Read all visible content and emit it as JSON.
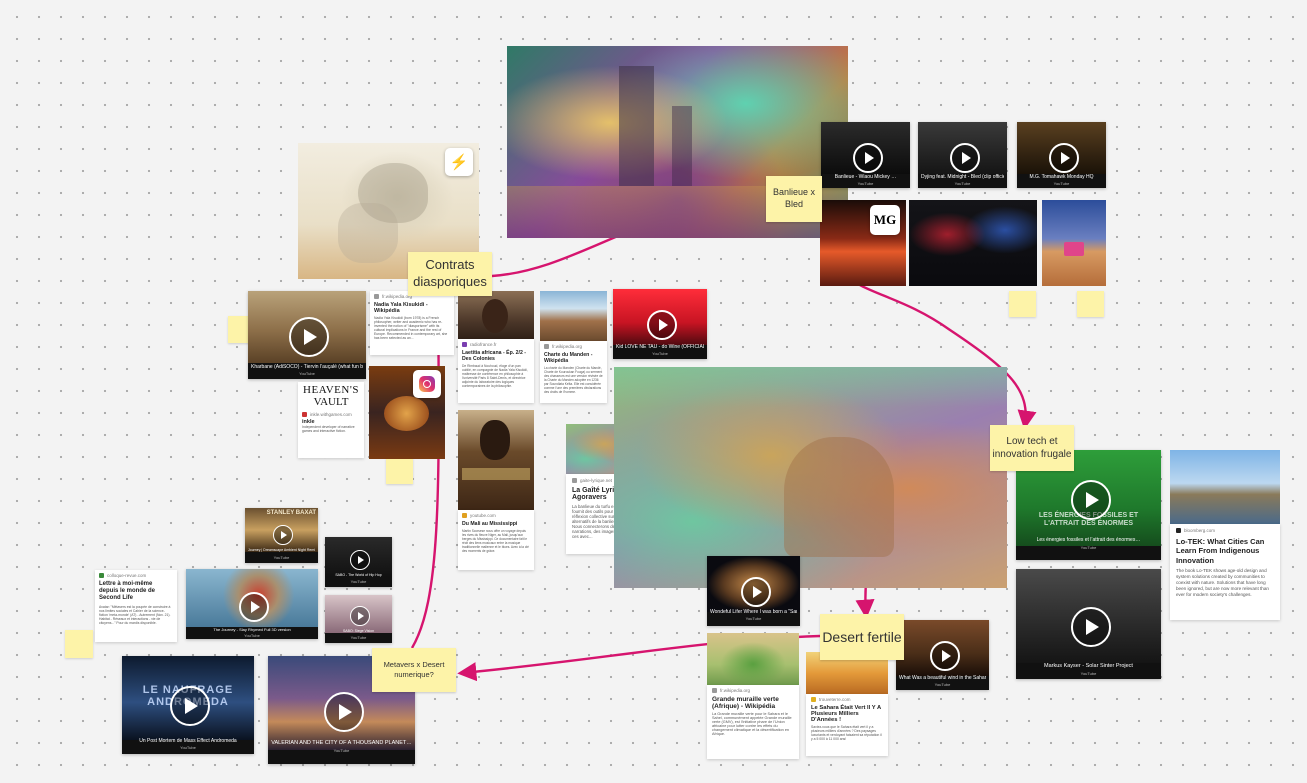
{
  "board": {
    "sticky_notes": {
      "contrats": "Contrats diasporiques",
      "banlieue": "Banlieue x Bled",
      "lowtech": "Low tech et innovation frugale",
      "desert": "Desert fertile",
      "metavers": "Metavers x Desert numerique?"
    },
    "cards": {
      "nadia": {
        "source": "fr.wikipedia.org",
        "title": "Nadia Yala Kisukidi - Wikipédia",
        "desc": "Nadia Yala Kisukidi (born 1978) is a French philosopher, writer and academic who has re-invented the notion of \"diasporisme\" with its cultural implications in France and the rest of Europe. Recommended in contemporary art, she has been selected as an..."
      },
      "inkle": {
        "logo_line1": "HEAVEN'S",
        "logo_line2": "VAULT",
        "source": "inkle.withgames.com",
        "title": "inkle",
        "desc": "Independent developer of narrative games and interactive fiction."
      },
      "laetitia": {
        "source": "radiofrance.fr",
        "title": "Laetitia africana - Ép. 2/2 - Des Colonies",
        "desc": "De Rimbaud à Nouhoud, éloge d'un pan oublié, en compagnie de Nadia Yala Kisukidi, maîtresse de conférence en philosophie à l'université Paris 8 Saint-Denis, et directrice adjointe du laboratoire des logiques contemporaines de la philosophie."
      },
      "charte": {
        "source": "fr.wikipedia.org",
        "title": "Charte du Manden - Wikipédia",
        "desc": "La charte du Manden (Charte du Mandé, Charte de Kouroukan Fouga) ou serment des chasseurs est une version révisée de la Charte du Manden adoptée en 1236 par Soundiata Keïta. Elle est considérée comme l'une des premières déclarations des droits de l'homme."
      },
      "mali": {
        "source": "youtube.com",
        "title": "Du Mali au Mississippi",
        "desc": "Martin Scorsese nous offre un voyage depuis les rives du fleuve Niger, au Mali, jusqu'aux berges du Mississippi. Ce documentaire fait le récit des liens musicaux entre la musique traditionnelle malienne et le blues. Avec à la clé des moments de grâce."
      },
      "gaite": {
        "source": "gaite-lyrique.net",
        "title": "La Gaîté Lyrique | Agoravers",
        "desc": "La banlieue du turfu est un safe space qui fournit des outils pour permettre une réflexion collective sur les imaginaires alternatifs de la banlieue dans le monde. Nous connecterons des expériences, des narrations, des images et des prototypes de ces avec..."
      },
      "lotek": {
        "source": "bloomberg.com",
        "title": "Lo-TEK: What Cities Can Learn From Indigenous Innovation",
        "desc": "The book Lo-TEK shows age-old design and system solutions created by communities to coexist with nature. Solutions that have long been ignored, but are now more relevant than ever for modern society's challenges."
      },
      "lettre": {
        "source": "colloque-revue.com",
        "title": "Lettre à moi-même depuis le monde de Second Life",
        "desc": "Avatar: \"Métavers est la poupée de construire à nos limites sociales et Cahier de la science-fiction 'meta-monde' (AT) - Autrement (Nov. 21). Habitat - Réseaux et interactions - vie de citoyens...\" Pour du mardis disponible."
      },
      "muraille": {
        "source": "fr.wikipedia.org",
        "title": "Grande muraille verte (Afrique) - Wikipédia",
        "desc": "La Grande muraille verte pour le Sahara et le Sahel, communément appelée Grande muraille verte (GMV), est l'initiative phare de l'Union africaine pour lutter contre les effets du changement climatique et la désertification en Afrique."
      },
      "sahara": {
        "source": "trouveterre.com",
        "title": "Le Sahara Était Vert Il Y A Plusieurs Milliers D'Années !",
        "desc": "Saviez-vous que le Sahara était vert il y a plusieurs milliers d'années ? Des paysages luxuriants et verdoyant faisaient sa réputation il y a 5 000 à 11 000 ans!"
      }
    },
    "videos": {
      "v_banlieue1": {
        "title": "Banlieue - Wiaou Mickey …",
        "source": "YouTube"
      },
      "v_banlieue2": {
        "title": "Dyjing feat. Midnight - Bled (clip officiel)",
        "source": "YouTube"
      },
      "v_banlieue3": {
        "title": "M.G. Tomahawk Monday HQ",
        "source": "YouTube"
      },
      "v_sahara_ar": {
        "title": "Kharbane (AdiSOCO) - Tiervin l’auçalé (what fun be…",
        "source": "YouTube"
      },
      "v_oudk": {
        "title": "Kid LOVE NE TAU - do Wine (OFFICIAL VIDEO)",
        "source": "YouTube"
      },
      "v_energies": {
        "title": "Les énergies fossiles et l’attrait des énormes…",
        "source": "YouTube",
        "overlay": "LES ÉNERGIES FOSSILES ET L'ATTRAIT DES ÉNORMES"
      },
      "v_solar": {
        "title": "Markus Kayser - Solar Sinter Project",
        "source": "YouTube"
      },
      "v_sand": {
        "title": "Wondeful Lifer Where I was born a \"Sand Surf\"",
        "source": "YouTube"
      },
      "v_desert": {
        "title": "What Was a beautiful wind in the Sahara desert",
        "source": "YouTube"
      },
      "v_jour": {
        "title": "Journey | Dreamscape Ambient Night Remix",
        "banner": "STANLEY BAXAT",
        "source": "YouTube"
      },
      "v_sabo": {
        "title": "SABO - The World of Hip Hop",
        "source": "YouTube"
      },
      "v_journey": {
        "title": "The Journey - Slay Rhymed Full 3D version",
        "source": "YouTube"
      },
      "v_sabo2": {
        "title": "SABO: Siege Vision",
        "source": "YouTube"
      },
      "v_andromeda": {
        "title": "Un Post Mortem de Mass Effect Andromeda",
        "overlay": "LE NAUFRAGE ANDROMEDA",
        "source": "YouTube"
      },
      "v_valerian": {
        "title": "VALERIAN AND THE CITY OF A THOUSAND PLANET…",
        "source": "YouTube"
      }
    },
    "badges": {
      "lightning": "⚡",
      "mg": "MG"
    },
    "colors": {
      "arrow": "#d6146e",
      "sticky": "#fdf3a8",
      "card_bg": "#ffffff",
      "video_bg": "#111111"
    }
  }
}
